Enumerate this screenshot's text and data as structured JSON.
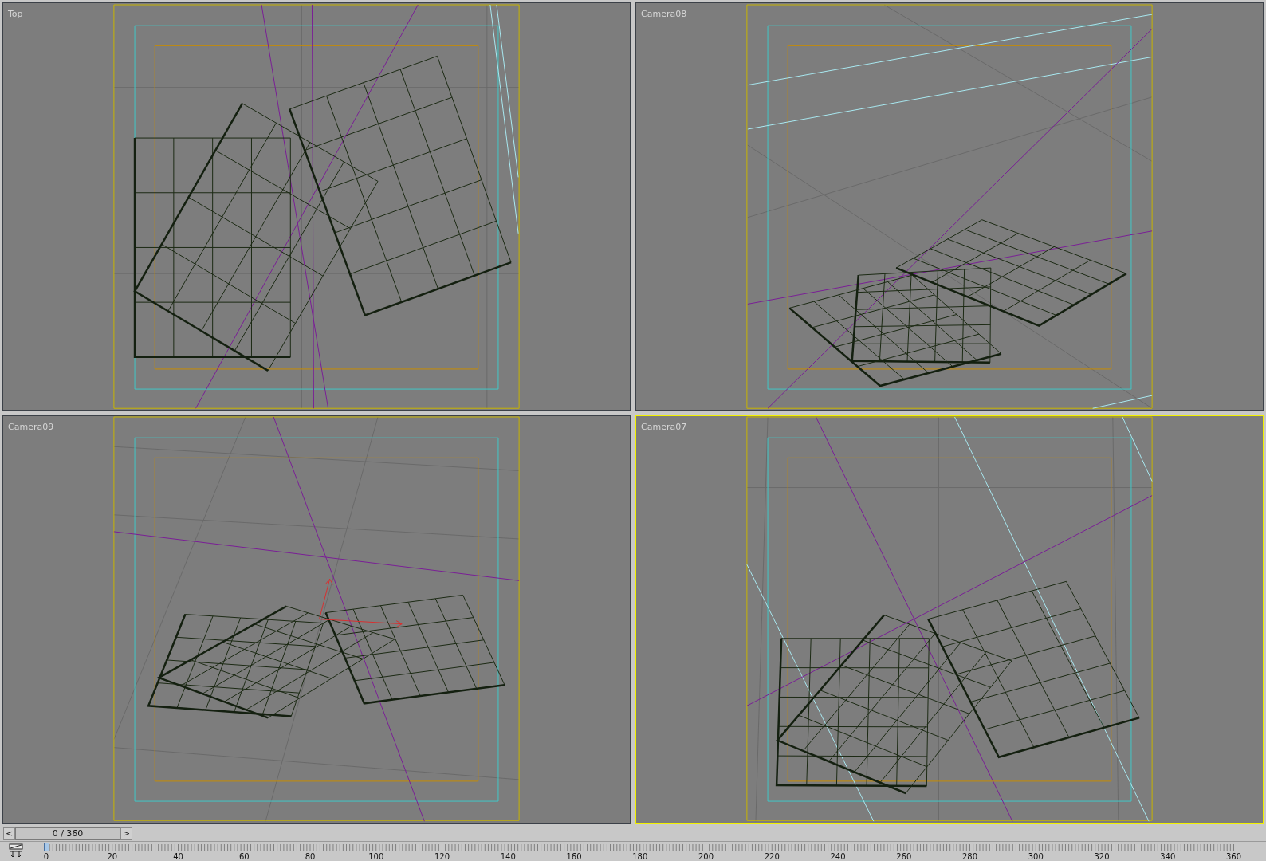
{
  "viewports": [
    {
      "label": "Top",
      "active": false
    },
    {
      "label": "Camera08",
      "active": false
    },
    {
      "label": "Camera09",
      "active": false
    },
    {
      "label": "Camera07",
      "active": true
    }
  ],
  "time_slider": {
    "prev": "<",
    "value": "0 / 360",
    "next": ">"
  },
  "track_bar": {
    "labels": [
      "0",
      "20",
      "40",
      "60",
      "80",
      "100",
      "120",
      "140",
      "160",
      "180",
      "200",
      "220",
      "240",
      "260",
      "280",
      "300",
      "320",
      "340",
      "360"
    ]
  }
}
